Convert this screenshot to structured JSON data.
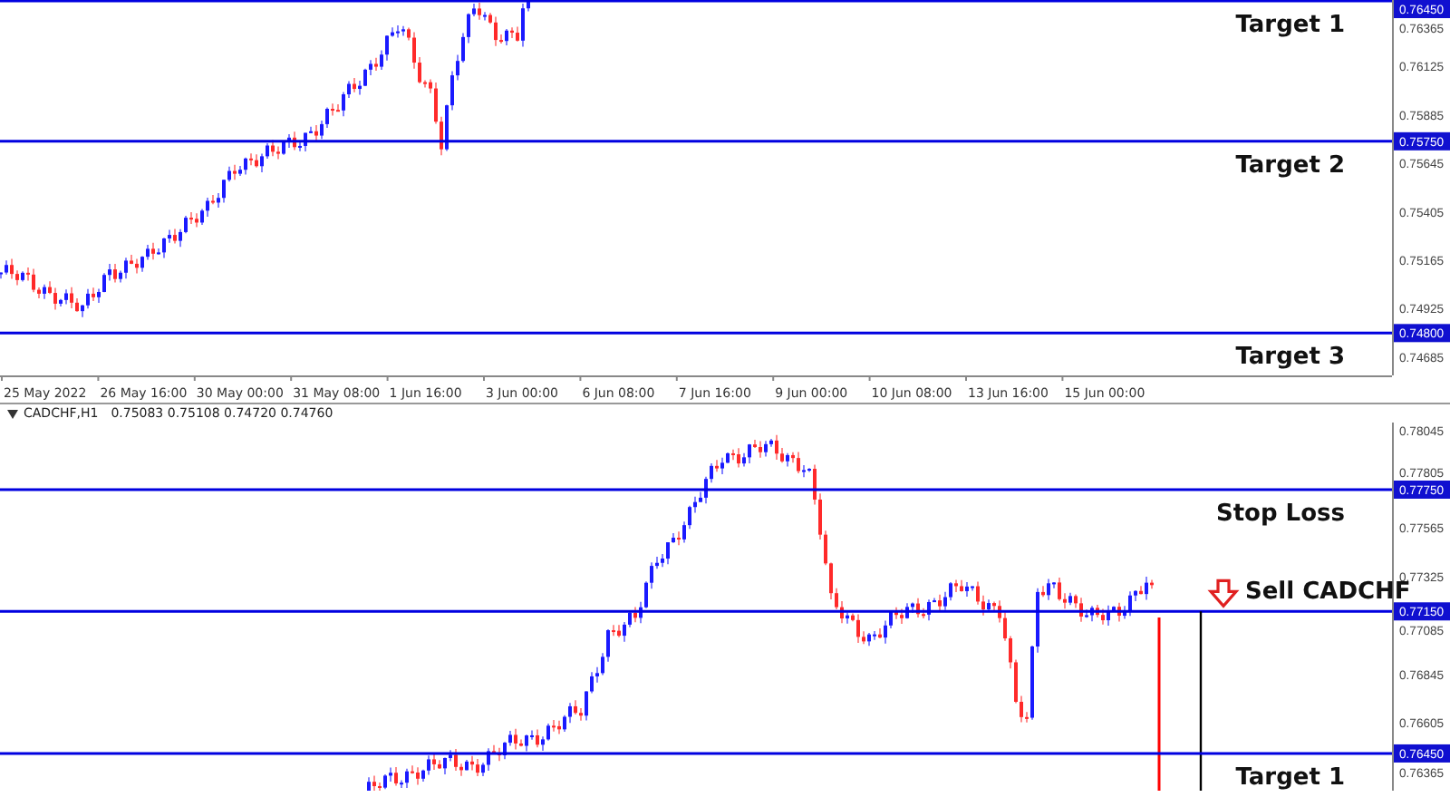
{
  "top_chart": {
    "price_ticks": [
      "0.76365",
      "0.76125",
      "0.75885",
      "0.75645",
      "0.75405",
      "0.75165",
      "0.74925",
      "0.74685"
    ],
    "levels": [
      {
        "price": "0.76450",
        "label": "Target 1",
        "kind": "target"
      },
      {
        "price": "0.75750",
        "label": "Target 2",
        "kind": "target"
      },
      {
        "price": "0.74800",
        "label": "Target 3",
        "kind": "target"
      }
    ],
    "time_labels": [
      "25 May 2022",
      "26 May 16:00",
      "30 May 00:00",
      "31 May 08:00",
      "1 Jun 16:00",
      "3 Jun 00:00",
      "6 Jun 08:00",
      "7 Jun 16:00",
      "9 Jun 00:00",
      "10 Jun 08:00",
      "13 Jun 16:00",
      "15 Jun 00:00"
    ]
  },
  "bottom_chart": {
    "header": {
      "symbol": "CADCHF,H1",
      "ohlc": "0.75083 0.75108 0.74720 0.74760"
    },
    "price_ticks": [
      "0.78045",
      "0.77805",
      "0.77565",
      "0.77325",
      "0.77085",
      "0.76845",
      "0.76605",
      "0.76365"
    ],
    "levels": [
      {
        "price": "0.77750",
        "label": "Stop Loss",
        "kind": "target"
      },
      {
        "price": "0.77150",
        "label": "Sell CADCHF",
        "kind": "signal"
      },
      {
        "price": "0.76450",
        "label": "Target 1",
        "kind": "target"
      }
    ]
  }
}
